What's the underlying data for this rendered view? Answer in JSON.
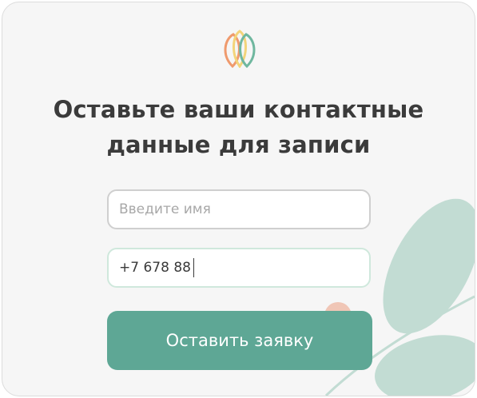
{
  "form": {
    "title_line1": "Оставьте ваши контактные",
    "title_line2": "данные для записи",
    "name_placeholder": "Введите имя",
    "phone_value": "+7 678 88",
    "submit_label": "Оставить заявку"
  },
  "colors": {
    "accent": "#5ea795",
    "leaf": "#c2dcd3",
    "petal_orange": "#ef9a6d",
    "petal_yellow": "#f3d47a",
    "petal_green": "#6fb79f",
    "berry": "#f0c6b6"
  },
  "icons": [
    "flower-logo-icon"
  ]
}
